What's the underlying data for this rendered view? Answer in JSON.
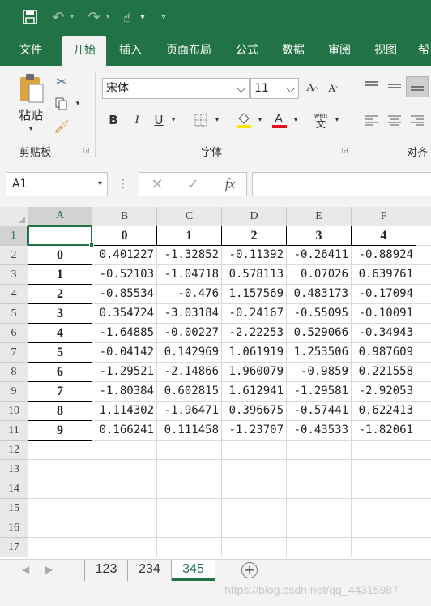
{
  "ribbon_tabs": [
    "文件",
    "开始",
    "插入",
    "页面布局",
    "公式",
    "数据",
    "审阅",
    "视图",
    "帮"
  ],
  "active_tab": "开始",
  "clipboard": {
    "paste_label": "粘贴",
    "group_label": "剪贴板"
  },
  "font": {
    "name": "宋体",
    "size": "11",
    "group_label": "字体",
    "phonetic_label": "wén",
    "phonetic_char": "文",
    "fill_color": "#ffe500",
    "font_color": "#e81123"
  },
  "alignment": {
    "group_label": "对齐"
  },
  "formula_bar": {
    "name_box": "A1",
    "formula": ""
  },
  "grid": {
    "columns": [
      "A",
      "B",
      "C",
      "D",
      "E",
      "F"
    ],
    "rows": [
      "1",
      "2",
      "3",
      "4",
      "5",
      "6",
      "7",
      "8",
      "9",
      "10",
      "11",
      "12",
      "13",
      "14",
      "15",
      "16",
      "17"
    ],
    "header_row": [
      "",
      "0",
      "1",
      "2",
      "3",
      "4"
    ],
    "data_rows": [
      [
        "0",
        "0.401227",
        "-1.32852",
        "-0.11392",
        "-0.26411",
        "-0.88924"
      ],
      [
        "1",
        "-0.52103",
        "-1.04718",
        "0.578113",
        "0.07026",
        "0.639761"
      ],
      [
        "2",
        "-0.85534",
        "-0.476",
        "1.157569",
        "0.483173",
        "-0.17094"
      ],
      [
        "3",
        "0.354724",
        "-3.03184",
        "-0.24167",
        "-0.55095",
        "-0.10091"
      ],
      [
        "4",
        "-1.64885",
        "-0.00227",
        "-2.22253",
        "0.529066",
        "-0.34943"
      ],
      [
        "5",
        "-0.04142",
        "0.142969",
        "1.061919",
        "1.253506",
        "0.987609"
      ],
      [
        "6",
        "-1.29521",
        "-2.14866",
        "1.960079",
        "-0.9859",
        "0.221558"
      ],
      [
        "7",
        "-1.80384",
        "0.602815",
        "1.612941",
        "-1.29581",
        "-2.92053"
      ],
      [
        "8",
        "1.114302",
        "-1.96471",
        "0.396675",
        "-0.57441",
        "0.622413"
      ],
      [
        "9",
        "0.166241",
        "0.111458",
        "-1.23707",
        "-0.43533",
        "-1.82061"
      ]
    ]
  },
  "sheets": [
    "123",
    "234",
    "345"
  ],
  "active_sheet": "345",
  "watermark": "https://blog.csdn.net/qq_44315987",
  "colors": {
    "brand": "#217346"
  }
}
